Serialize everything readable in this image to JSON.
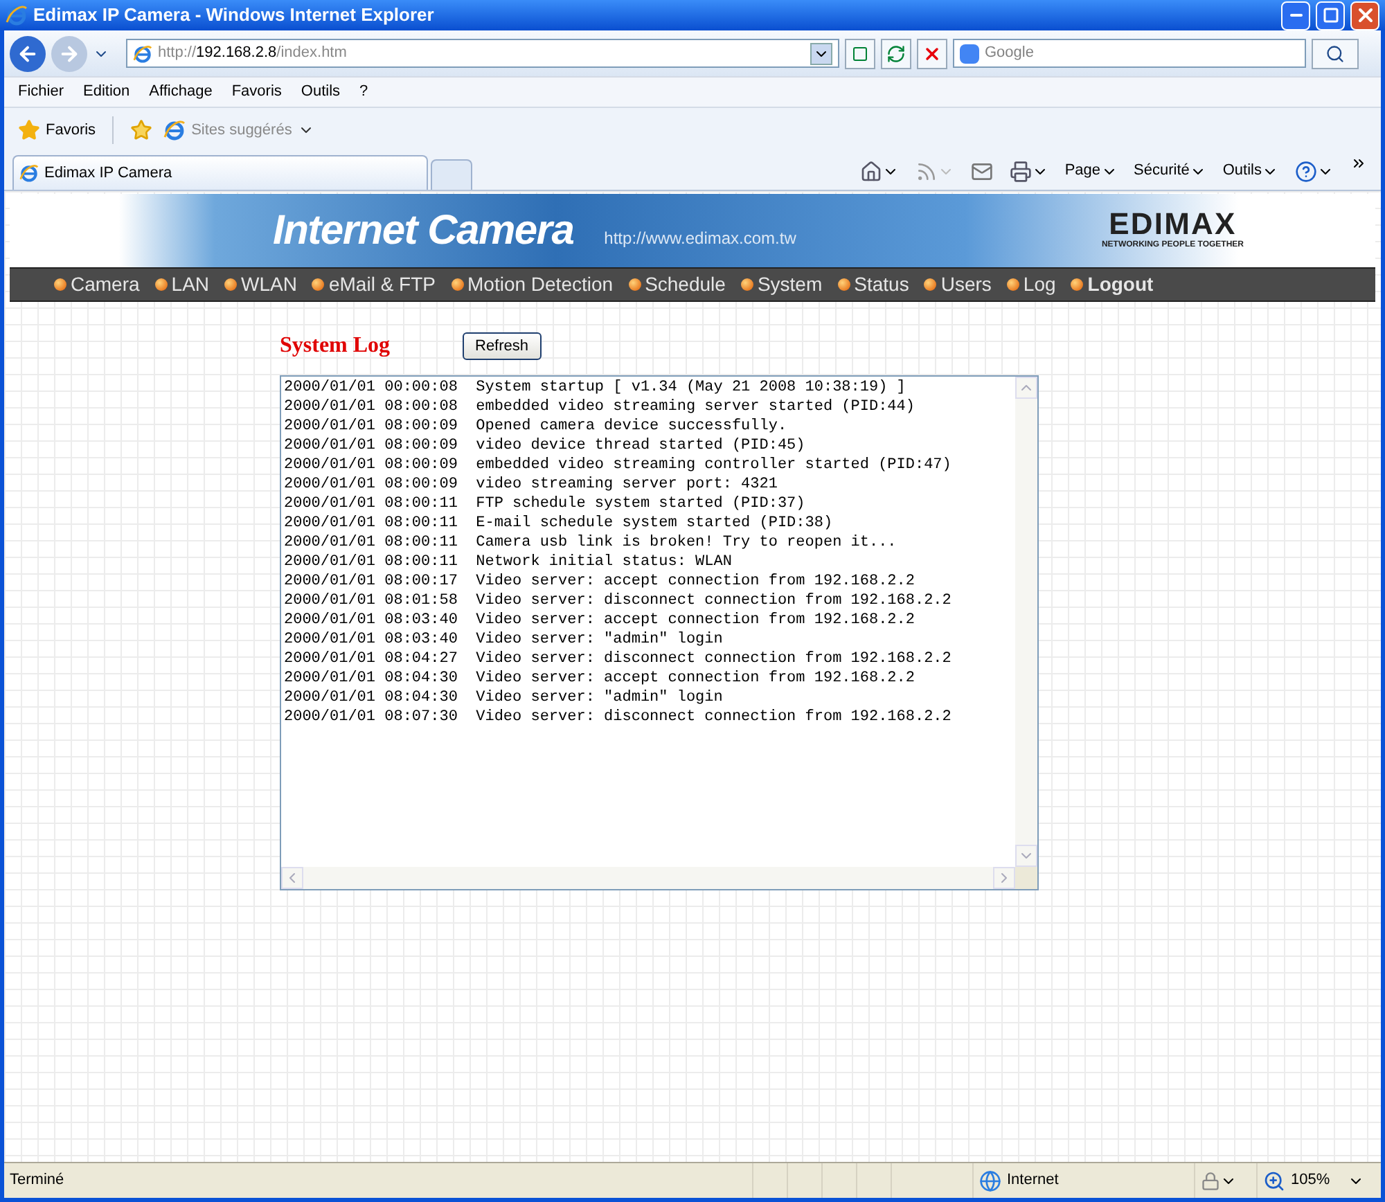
{
  "window": {
    "title": "Edimax IP Camera - Windows Internet Explorer"
  },
  "address_bar": {
    "url_prefix": "http://",
    "url_host": "192.168.2.8",
    "url_path": "/index.htm"
  },
  "search": {
    "placeholder": "Google"
  },
  "menu": [
    "Fichier",
    "Edition",
    "Affichage",
    "Favoris",
    "Outils",
    "?"
  ],
  "favorites_bar": {
    "favorites": "Favoris",
    "suggested": "Sites suggérés"
  },
  "tabs": [
    {
      "label": "Edimax IP Camera",
      "selected": true
    }
  ],
  "command_bar": [
    "Page",
    "Sécurité",
    "Outils"
  ],
  "banner": {
    "title": "Internet Camera",
    "url": "http://www.edimax.com.tw",
    "logo": "EDIMAX",
    "tagline": "NETWORKING PEOPLE TOGETHER"
  },
  "nav": [
    {
      "label": "Camera",
      "bold": false
    },
    {
      "label": "LAN",
      "bold": false
    },
    {
      "label": "WLAN",
      "bold": false
    },
    {
      "label": "eMail & FTP",
      "bold": false
    },
    {
      "label": "Motion Detection",
      "bold": false
    },
    {
      "label": "Schedule",
      "bold": false
    },
    {
      "label": "System",
      "bold": false
    },
    {
      "label": "Status",
      "bold": false
    },
    {
      "label": "Users",
      "bold": false
    },
    {
      "label": "Log",
      "bold": false
    },
    {
      "label": "Logout",
      "bold": true
    }
  ],
  "page": {
    "title": "System Log",
    "refresh_button": "Refresh"
  },
  "log_lines": [
    "2000/01/01 00:00:08  System startup [ v1.34 (May 21 2008 10:38:19) ]",
    "2000/01/01 08:00:08  embedded video streaming server started (PID:44)",
    "2000/01/01 08:00:09  Opened camera device successfully.",
    "2000/01/01 08:00:09  video device thread started (PID:45)",
    "2000/01/01 08:00:09  embedded video streaming controller started (PID:47)",
    "2000/01/01 08:00:09  video streaming server port: 4321",
    "2000/01/01 08:00:11  FTP schedule system started (PID:37)",
    "2000/01/01 08:00:11  E-mail schedule system started (PID:38)",
    "2000/01/01 08:00:11  Camera usb link is broken! Try to reopen it...",
    "2000/01/01 08:00:11  Network initial status: WLAN",
    "2000/01/01 08:00:17  Video server: accept connection from 192.168.2.2",
    "2000/01/01 08:01:58  Video server: disconnect connection from 192.168.2.2",
    "2000/01/01 08:03:40  Video server: accept connection from 192.168.2.2",
    "2000/01/01 08:03:40  Video server: \"admin\" login",
    "2000/01/01 08:04:27  Video server: disconnect connection from 192.168.2.2",
    "2000/01/01 08:04:30  Video server: accept connection from 192.168.2.2",
    "2000/01/01 08:04:30  Video server: \"admin\" login",
    "2000/01/01 08:07:30  Video server: disconnect connection from 192.168.2.2"
  ],
  "status_bar": {
    "text": "Terminé",
    "zone": "Internet",
    "zoom": "105%"
  }
}
